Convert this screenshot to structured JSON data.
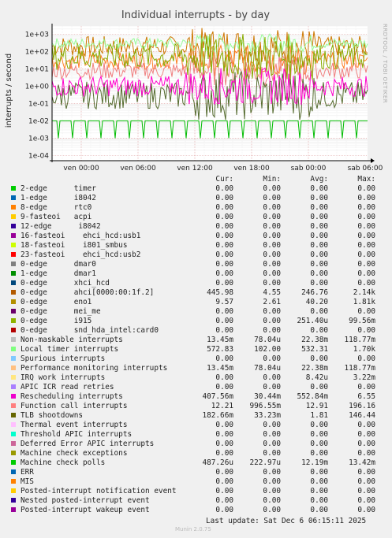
{
  "chart_data": {
    "type": "line",
    "title": "Individual interrupts - by day",
    "ylabel": "interrupts / second",
    "yscale": "log",
    "ylim": [
      5e-05,
      3000
    ],
    "y_ticks": [
      "1e+03",
      "1e+02",
      "1e+01",
      "1e+00",
      "1e-01",
      "1e-02",
      "1e-03",
      "1e-04"
    ],
    "x_ticks": [
      "ven 00:00",
      "ven 06:00",
      "ven 12:00",
      "ven 18:00",
      "sab 00:00",
      "sab 06:00"
    ],
    "grid": true,
    "series": [
      {
        "name": "ahci[0000:00:1f.2]",
        "color": "#cc7700",
        "level": 200,
        "spread": 1.2
      },
      {
        "name": "Local timer interrupts",
        "color": "#98fb98",
        "level": 300,
        "spread": 0.6
      },
      {
        "name": "eno1",
        "color": "#ff7f24",
        "level": 30,
        "spread": 1.0
      },
      {
        "name": "Function call interrupts",
        "color": "#f08080",
        "level": 8,
        "spread": 1.0
      },
      {
        "name": "TLB shootdowns",
        "color": "#556b2f",
        "level": 0.3,
        "spread": 1.6
      },
      {
        "name": "Rescheduling interrupts",
        "color": "#ff00cc",
        "level": 1,
        "spread": 1.2
      },
      {
        "name": "Machine check polls",
        "color": "#00bb00",
        "level": 0.01,
        "spread": 0
      },
      {
        "name": "i915",
        "color": "#88aa00",
        "level": 50,
        "spread": 1.5
      }
    ]
  },
  "side_text": "RRDTOOL / TOBI OETIKER",
  "columns": [
    "Cur:",
    "Min:",
    "Avg:",
    "Max:"
  ],
  "legend": [
    {
      "color": "#00cc00",
      "label": "2-edge      timer",
      "cur": "0.00",
      "min": "0.00",
      "avg": "0.00",
      "max": "0.00"
    },
    {
      "color": "#0066b3",
      "label": "1-edge      i8042",
      "cur": "0.00",
      "min": "0.00",
      "avg": "0.00",
      "max": "0.00"
    },
    {
      "color": "#ff8000",
      "label": "8-edge      rtc0",
      "cur": "0.00",
      "min": "0.00",
      "avg": "0.00",
      "max": "0.00"
    },
    {
      "color": "#ffcc00",
      "label": "9-fasteoi   acpi",
      "cur": "0.00",
      "min": "0.00",
      "avg": "0.00",
      "max": "0.00"
    },
    {
      "color": "#330099",
      "label": "12-edge      i8042",
      "cur": "0.00",
      "min": "0.00",
      "avg": "0.00",
      "max": "0.00"
    },
    {
      "color": "#990099",
      "label": "16-fasteoi    ehci_hcd:usb1",
      "cur": "0.00",
      "min": "0.00",
      "avg": "0.00",
      "max": "0.00"
    },
    {
      "color": "#ccff00",
      "label": "18-fasteoi    i801_smbus",
      "cur": "0.00",
      "min": "0.00",
      "avg": "0.00",
      "max": "0.00"
    },
    {
      "color": "#ff0000",
      "label": "23-fasteoi    ehci_hcd:usb2",
      "cur": "0.00",
      "min": "0.00",
      "avg": "0.00",
      "max": "0.00"
    },
    {
      "color": "#808080",
      "label": "0-edge      dmar0",
      "cur": "0.00",
      "min": "0.00",
      "avg": "0.00",
      "max": "0.00"
    },
    {
      "color": "#008f00",
      "label": "1-edge      dmar1",
      "cur": "0.00",
      "min": "0.00",
      "avg": "0.00",
      "max": "0.00"
    },
    {
      "color": "#00487d",
      "label": "0-edge      xhci_hcd",
      "cur": "0.00",
      "min": "0.00",
      "avg": "0.00",
      "max": "0.00"
    },
    {
      "color": "#b35a00",
      "label": "0-edge      ahci[0000:00:1f.2]",
      "cur": "445.98",
      "min": "4.55",
      "avg": "246.76",
      "max": "2.14k"
    },
    {
      "color": "#b38f00",
      "label": "0-edge      eno1",
      "cur": "9.57",
      "min": "2.61",
      "avg": "40.20",
      "max": "1.81k"
    },
    {
      "color": "#6b006b",
      "label": "0-edge      mei_me",
      "cur": "0.00",
      "min": "0.00",
      "avg": "0.00",
      "max": "0.00"
    },
    {
      "color": "#8fb300",
      "label": "0-edge      i915",
      "cur": "0.00",
      "min": "0.00",
      "avg": "251.40u",
      "max": "99.56m"
    },
    {
      "color": "#b30000",
      "label": "0-edge      snd_hda_intel:card0",
      "cur": "0.00",
      "min": "0.00",
      "avg": "0.00",
      "max": "0.00"
    },
    {
      "color": "#bebebe",
      "label": "Non-maskable interrupts",
      "cur": "13.45m",
      "min": "78.04u",
      "avg": "22.38m",
      "max": "118.77m"
    },
    {
      "color": "#80ff80",
      "label": "Local timer interrupts",
      "cur": "572.83",
      "min": "102.00",
      "avg": "532.31",
      "max": "1.70k"
    },
    {
      "color": "#80c9ff",
      "label": "Spurious interrupts",
      "cur": "0.00",
      "min": "0.00",
      "avg": "0.00",
      "max": "0.00"
    },
    {
      "color": "#ffc080",
      "label": "Performance monitoring interrupts",
      "cur": "13.45m",
      "min": "78.04u",
      "avg": "22.38m",
      "max": "118.77m"
    },
    {
      "color": "#ffe680",
      "label": "IRQ work interrupts",
      "cur": "0.00",
      "min": "0.00",
      "avg": "8.42u",
      "max": "3.22m"
    },
    {
      "color": "#aa80ff",
      "label": "APIC ICR read retries",
      "cur": "0.00",
      "min": "0.00",
      "avg": "0.00",
      "max": "0.00"
    },
    {
      "color": "#ee00cc",
      "label": "Rescheduling interrupts",
      "cur": "407.56m",
      "min": "30.44m",
      "avg": "552.84m",
      "max": "6.55"
    },
    {
      "color": "#ff8080",
      "label": "Function call interrupts",
      "cur": "12.21",
      "min": "996.55m",
      "avg": "12.91",
      "max": "196.16"
    },
    {
      "color": "#666600",
      "label": "TLB shootdowns",
      "cur": "182.66m",
      "min": "33.23m",
      "avg": "1.81",
      "max": "146.44"
    },
    {
      "color": "#ffbfff",
      "label": "Thermal event interrupts",
      "cur": "0.00",
      "min": "0.00",
      "avg": "0.00",
      "max": "0.00"
    },
    {
      "color": "#00ffcc",
      "label": "Threshold APIC interrupts",
      "cur": "0.00",
      "min": "0.00",
      "avg": "0.00",
      "max": "0.00"
    },
    {
      "color": "#cc6699",
      "label": "Deferred Error APIC interrupts",
      "cur": "0.00",
      "min": "0.00",
      "avg": "0.00",
      "max": "0.00"
    },
    {
      "color": "#999900",
      "label": "Machine check exceptions",
      "cur": "0.00",
      "min": "0.00",
      "avg": "0.00",
      "max": "0.00"
    },
    {
      "color": "#00cc00",
      "label": "Machine check polls",
      "cur": "487.26u",
      "min": "222.97u",
      "avg": "12.19m",
      "max": "13.42m"
    },
    {
      "color": "#0066b3",
      "label": "ERR",
      "cur": "0.00",
      "min": "0.00",
      "avg": "0.00",
      "max": "0.00"
    },
    {
      "color": "#ff8000",
      "label": "MIS",
      "cur": "0.00",
      "min": "0.00",
      "avg": "0.00",
      "max": "0.00"
    },
    {
      "color": "#ffcc00",
      "label": "Posted-interrupt notification event",
      "cur": "0.00",
      "min": "0.00",
      "avg": "0.00",
      "max": "0.00"
    },
    {
      "color": "#330099",
      "label": "Nested posted-interrupt event",
      "cur": "0.00",
      "min": "0.00",
      "avg": "0.00",
      "max": "0.00"
    },
    {
      "color": "#990099",
      "label": "Posted-interrupt wakeup event",
      "cur": "0.00",
      "min": "0.00",
      "avg": "0.00",
      "max": "0.00"
    }
  ],
  "footer": "Last update: Sat Dec  6 06:15:11 2025",
  "munin": "Munin 2.0.75"
}
